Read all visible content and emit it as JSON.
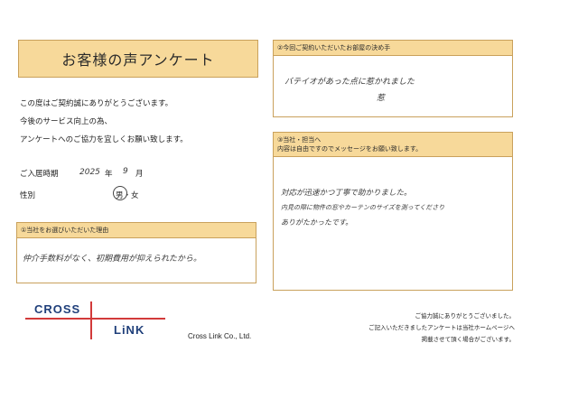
{
  "header": {
    "title": "お客様の声アンケート"
  },
  "intro_lines": [
    "この度はご契約誠にありがとうございます。",
    "今後のサービス向上の為、",
    "アンケートへのご協力を宜しくお願い致します。"
  ],
  "fields": {
    "move_in_label": "ご入居時期",
    "year_value": "2025",
    "year_unit": "年",
    "month_value": "9",
    "month_unit": "月",
    "gender_label": "性別",
    "gender_options": "男・女"
  },
  "q1": {
    "heading": "①当社をお選びいただいた理由",
    "answer": "仲介手数料がなく、初期費用が抑えられたから。"
  },
  "q2": {
    "heading": "②今回ご契約いただいたお部屋の決め手",
    "answer_line1": "バテイオがあった点に惹かれました",
    "answer_line2": "惹"
  },
  "q3": {
    "heading_line1": "③当社・担当へ",
    "heading_line2": "内容は自由ですのでメッセージをお願い致します。",
    "answer_line1": "対応が迅速かつ丁寧で助かりました。",
    "answer_line2": "内見の際に物件の窓やカーテンのサイズを測ってくださり",
    "answer_line3": "ありがたかったです。"
  },
  "logo": {
    "top": "CROSS",
    "bottom": "LiNK"
  },
  "company": "Cross Link Co., Ltd.",
  "footer_lines": [
    "ご協力誠にありがとうございました。",
    "ご記入いただきましたアンケートは当社ホームページへ",
    "掲載させて頂く場合がございます。"
  ],
  "colors": {
    "accent_fill": "#f7d99a",
    "accent_border": "#c9a15c",
    "logo_blue": "#1f3f7a",
    "logo_red": "#d23a3a"
  }
}
